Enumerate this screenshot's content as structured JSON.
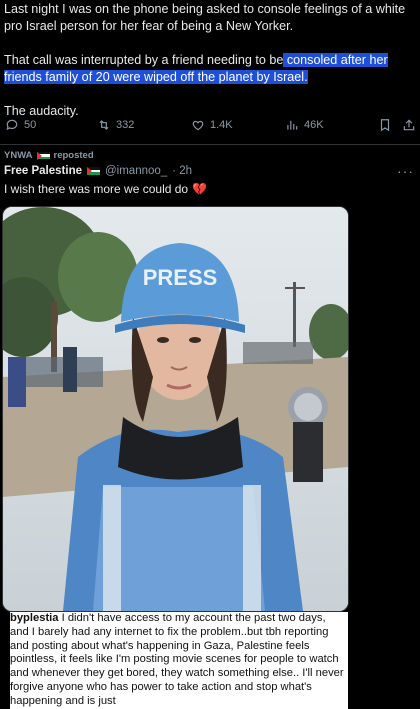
{
  "tweet1": {
    "paragraph1": "Last night I was on the phone being asked to console feelings of a white pro Israel person for her fear of being a New Yorker.",
    "paragraph2_plain": "That call was interrupted by a friend needing to be",
    "paragraph2_highlight": " consoled after her friends family of 20 were wiped off the planet by Israel.",
    "paragraph3": "The audacity.",
    "stats": {
      "replies": "50",
      "reposts": "332",
      "likes": "1.4K",
      "views": "46K"
    }
  },
  "tweet2": {
    "reposted_by": "YNWA",
    "reposted_label": "reposted",
    "author_name": "Free Palestine",
    "author_handle": "@imannoo_",
    "time": "· 2h",
    "more": "···",
    "text": "I wish there was more we could do",
    "emoji": "💔",
    "media": {
      "helmet_text": "PRESS",
      "caption_user": "byplestia",
      "caption_text": " I didn't have access to my account the past two days, and I barely had any internet to fix the problem..but tbh reporting and posting about what's happening in Gaza, Palestine feels pointless, it feels like I'm posting movie scenes for people to watch and whenever they get bored, they watch something else.. I'll never forgive anyone who has power to take action and stop what's happening and is just"
    }
  },
  "colors": {
    "background": "#000000",
    "text": "#e7e9ea",
    "muted": "#8b98a5",
    "highlight": "#1d4fd8",
    "divider": "#2f3336"
  },
  "icons": [
    "reply-icon",
    "repost-icon",
    "like-icon",
    "views-icon",
    "bookmark-icon",
    "share-icon",
    "palestine-flag-icon",
    "broken-heart-icon",
    "more-icon"
  ]
}
